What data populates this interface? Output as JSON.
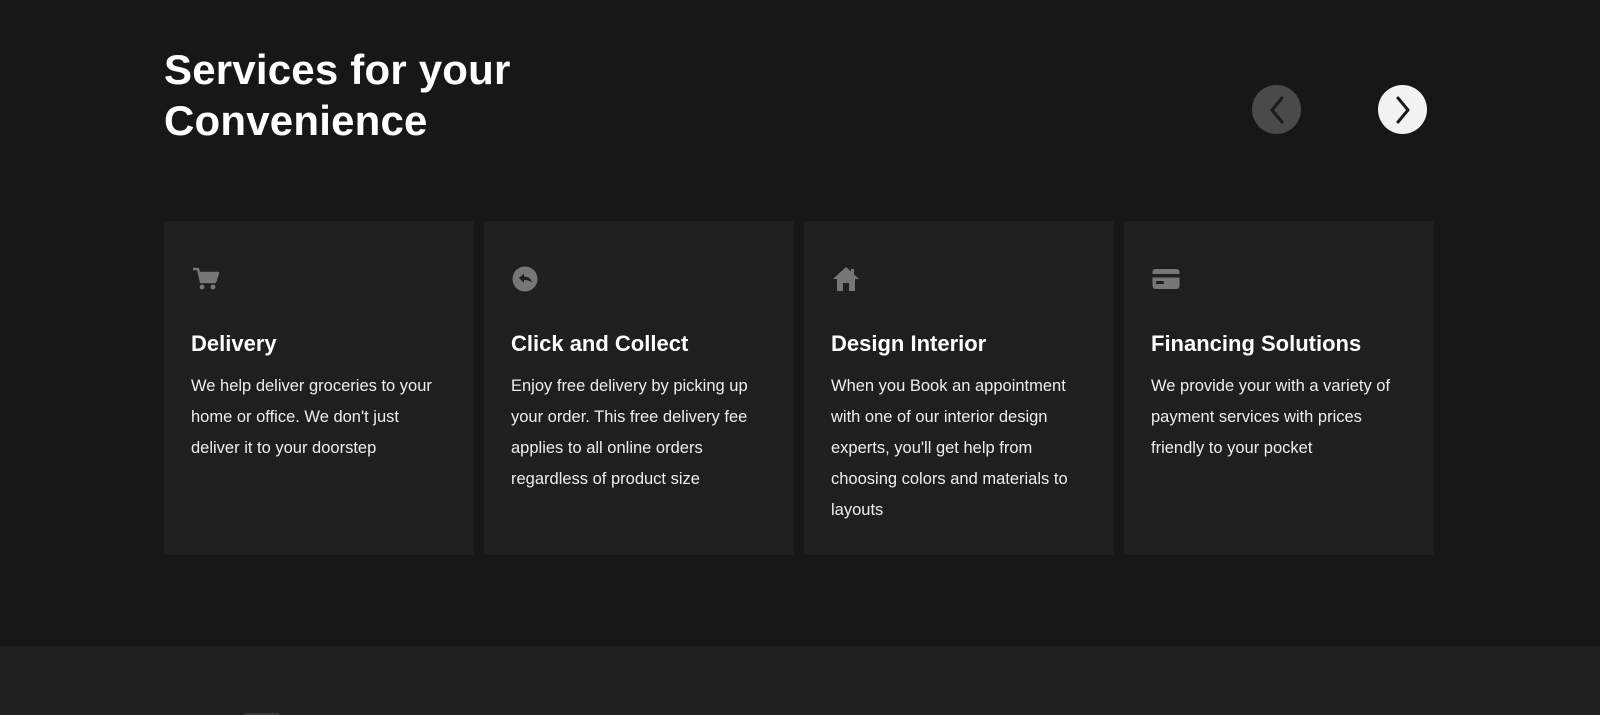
{
  "section": {
    "title_line1": "Services for your",
    "title_line2": "Convenience"
  },
  "carousel": {
    "prev_icon": "chevron-left-icon",
    "next_icon": "chevron-right-icon",
    "prev_bg": "#4a4a4a",
    "next_bg": "#f2f2f2"
  },
  "cards": [
    {
      "icon": "cart-icon",
      "title": "Delivery",
      "text": "We help deliver groceries to your home or office. We don't just deliver it to your doorstep"
    },
    {
      "icon": "return-arrow-icon",
      "title": "Click and Collect",
      "text": "Enjoy free delivery by picking up your order. This free delivery fee applies to all online orders regardless of product size"
    },
    {
      "icon": "home-icon",
      "title": "Design Interior",
      "text": "When you Book an appointment with one of our interior design experts, you'll get help from choosing colors and materials to layouts"
    },
    {
      "icon": "credit-card-icon",
      "title": "Financing Solutions",
      "text": "We provide your with a variety of payment services with prices friendly to your pocket"
    }
  ],
  "colors": {
    "page_bg": "#171717",
    "card_bg": "#1f1f1f",
    "icon_color": "#777777"
  }
}
